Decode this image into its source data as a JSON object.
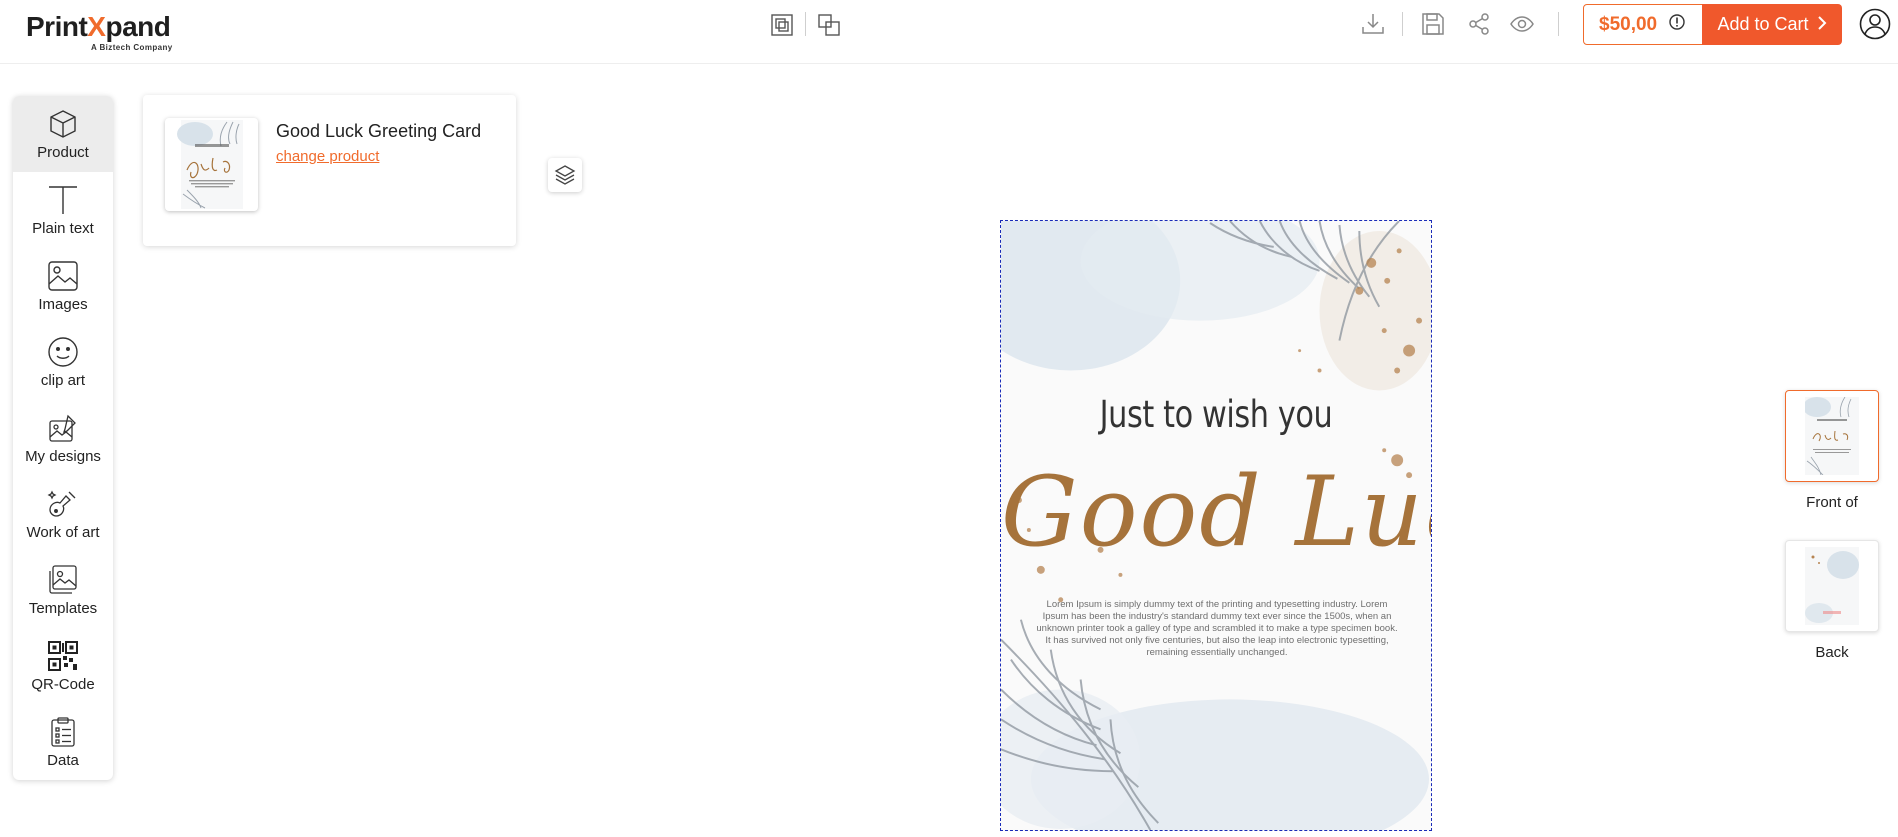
{
  "brand": {
    "name_part1": "Print",
    "name_part2": "X",
    "name_part3": "pand",
    "tagline": "A Biztech Company"
  },
  "toolbar": {
    "price": "$50,00",
    "add_to_cart": "Add to Cart"
  },
  "sidebar": {
    "items": [
      {
        "label": "Product",
        "icon": "cube-icon"
      },
      {
        "label": "Plain text",
        "icon": "text-icon"
      },
      {
        "label": "Images",
        "icon": "image-icon"
      },
      {
        "label": "clip art",
        "icon": "smiley-icon"
      },
      {
        "label": "My designs",
        "icon": "my-designs-icon"
      },
      {
        "label": "Work of art",
        "icon": "art-icon"
      },
      {
        "label": "Templates",
        "icon": "templates-icon"
      },
      {
        "label": "QR-Code",
        "icon": "qr-code-icon"
      },
      {
        "label": "Data",
        "icon": "clipboard-icon"
      }
    ]
  },
  "product": {
    "name": "Good Luck Greeting Card",
    "change_label": "change product"
  },
  "card": {
    "headline": "Just to wish you",
    "script": "Good Luck",
    "body": "Lorem Ipsum is simply dummy text of the printing and typesetting industry. Lorem Ipsum has been the industry's standard dummy text ever since the 1500s, when an unknown printer took a galley of type and scrambled it to make a type specimen book. It has survived not only five centuries, but also the leap into electronic typesetting, remaining essentially unchanged."
  },
  "sides": {
    "front_label": "Front of",
    "back_label": "Back"
  },
  "colors": {
    "accent": "#f06b2c",
    "cart_button": "#f0582c",
    "script": "#a6733b"
  }
}
